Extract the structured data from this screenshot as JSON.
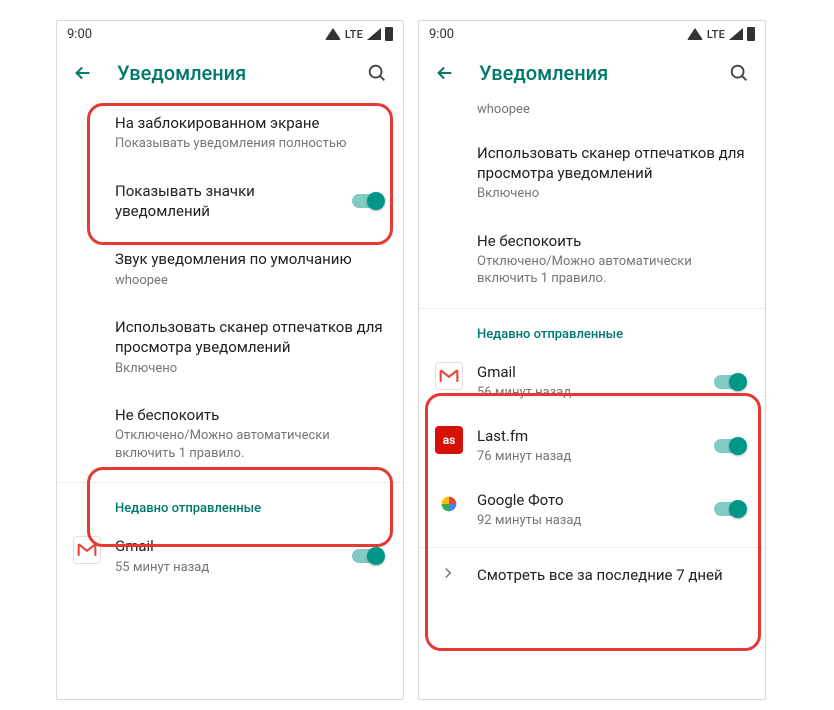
{
  "status": {
    "time": "9:00",
    "lte": "LTE"
  },
  "header": {
    "title": "Уведомления"
  },
  "left": {
    "lockscreen": {
      "title": "На заблокированном экране",
      "sub": "Показывать уведомления полностью"
    },
    "badges": {
      "title": "Показывать значки уведомлений"
    },
    "sound": {
      "title": "Звук уведомления по умолчанию",
      "sub": "whoopee"
    },
    "fingerprint": {
      "title": "Использовать сканер отпечатков для просмотра уведомлений",
      "sub": "Включено"
    },
    "dnd": {
      "title": "Не беспокоить",
      "sub": "Отключено/Можно автоматически включить 1 правило."
    },
    "recent_header": "Недавно отправленные",
    "gmail": {
      "title": "Gmail",
      "sub": "55 минут назад"
    }
  },
  "right": {
    "top_sub": "whoopee",
    "fingerprint": {
      "title": "Использовать сканер отпечатков для просмотра уведомлений",
      "sub": "Включено"
    },
    "dnd": {
      "title": "Не беспокоить",
      "sub": "Отключено/Можно автоматически включить 1 правило."
    },
    "recent_header": "Недавно отправленные",
    "apps": {
      "gmail": {
        "title": "Gmail",
        "sub": "56 минут назад"
      },
      "lastfm": {
        "title": "Last.fm",
        "sub": "76 минут назад"
      },
      "photos": {
        "title": "Google Фото",
        "sub": "92 минуты назад"
      }
    },
    "see_all": "Смотреть все за последние 7 дней"
  },
  "icons": {
    "lastfm_glyph": "as"
  }
}
